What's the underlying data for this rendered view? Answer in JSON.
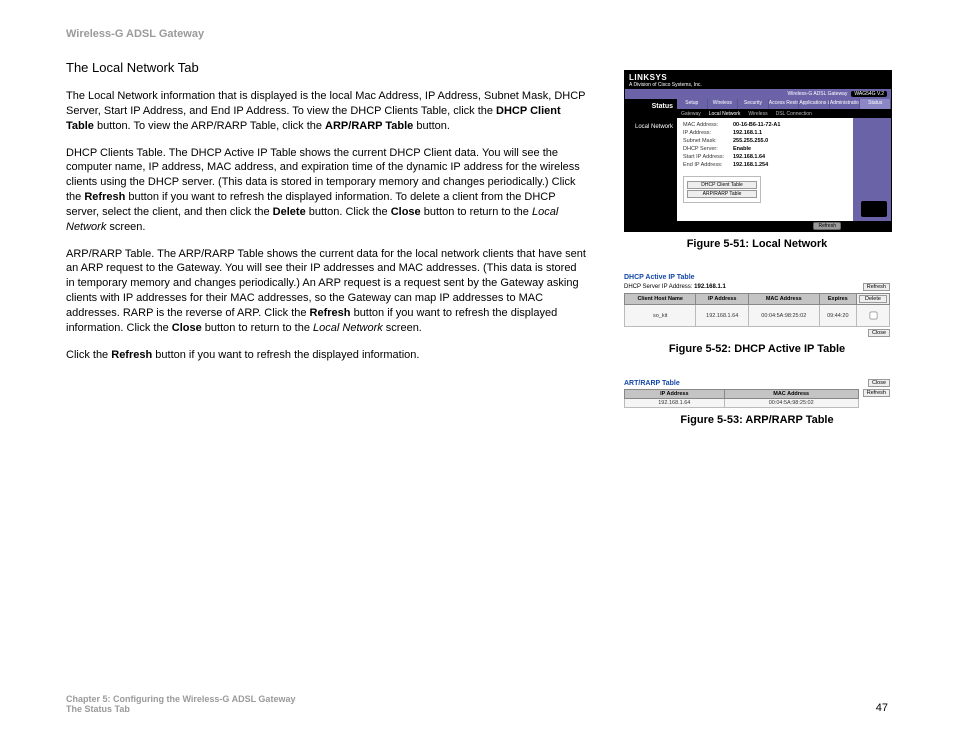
{
  "header": {
    "product": "Wireless-G ADSL Gateway"
  },
  "section": {
    "title": "The Local Network Tab",
    "p1_a": "The Local Network information that is displayed is the local Mac Address, IP Address, Subnet Mask, DHCP Server, Start IP Address, and End IP Address. To view the DHCP Clients Table, click the ",
    "p1_b1": "DHCP Client Table",
    "p1_c": " button. To view the ARP/RARP Table, click the ",
    "p1_b2": "ARP/RARP Table",
    "p1_d": " button.",
    "p2_a": "DHCP Clients Table. The DHCP Active IP Table shows the current DHCP Client data. You will see the computer name, IP address, MAC address, and expiration time of the dynamic IP address for the wireless clients using the DHCP server. (This data is stored in temporary memory and changes periodically.) Click the ",
    "p2_b1": "Refresh",
    "p2_c": " button if you want to refresh the displayed information. To delete a client from the DHCP server, select the client, and then click the ",
    "p2_b2": "Delete",
    "p2_d": " button. Click the ",
    "p2_b3": "Close",
    "p2_e": " button to return to the ",
    "p2_i": "Local Network",
    "p2_f": " screen.",
    "p3_a": "ARP/RARP Table. The ARP/RARP Table shows the current data for the local network clients that have sent an ARP request to the Gateway. You will see their IP addresses and MAC addresses. (This data is stored in temporary memory and changes periodically.) An ARP request is a request sent by the Gateway asking clients with IP addresses for their MAC addresses, so the Gateway can map IP addresses to MAC addresses. RARP is the reverse of ARP. Click the ",
    "p3_b1": "Refresh",
    "p3_c": " button if you want to refresh the displayed information. Click the ",
    "p3_b2": "Close",
    "p3_d": " button to return to the ",
    "p3_i": "Local Network",
    "p3_e": " screen.",
    "p4_a": "Click the ",
    "p4_b1": "Refresh",
    "p4_c": " button if you want to refresh the displayed information."
  },
  "fig51": {
    "caption": "Figure 5-51: Local Network",
    "brand": "LINKSYS",
    "brand_sub": "A Division of Cisco Systems, Inc.",
    "firmware": "Wireless-G ADSL Gateway",
    "model": "WAG54G V.2",
    "status_label": "Status",
    "tabs": [
      "Setup",
      "Wireless",
      "Security",
      "Access Restrictions",
      "Applications & Gaming",
      "Administration",
      "Status"
    ],
    "subtabs": [
      "Gateway",
      "Local Network",
      "Wireless",
      "DSL Connection"
    ],
    "side_label": "Local Network",
    "rows": [
      {
        "k": "MAC Address:",
        "v": "00-16-B6-11-72-A1"
      },
      {
        "k": "IP Address:",
        "v": "192.168.1.1"
      },
      {
        "k": "Subnet Mask:",
        "v": "255.255.255.0"
      },
      {
        "k": "DHCP Server:",
        "v": "Enable"
      },
      {
        "k": "Start IP Address:",
        "v": "192.168.1.64"
      },
      {
        "k": "End IP Address:",
        "v": "192.168.1.254"
      }
    ],
    "btn1": "DHCP Client Table",
    "btn2": "ARP/RARP Table",
    "refresh": "Refresh"
  },
  "fig52": {
    "caption": "Figure 5-52: DHCP Active IP Table",
    "title": "DHCP Active IP Table",
    "server_label": "DHCP Server IP Address:",
    "server_value": "192.168.1.1",
    "refresh": "Refresh",
    "headers": [
      "Client Host Name",
      "IP Address",
      "MAC Address",
      "Expires"
    ],
    "row": [
      "so_kit",
      "192.168.1.64",
      "00:04:5A:98:25:02",
      "09:44:20"
    ],
    "delete": "Delete",
    "close": "Close"
  },
  "fig53": {
    "caption": "Figure 5-53: ARP/RARP Table",
    "title": "ART/RARP Table",
    "close": "Close",
    "refresh": "Refresh",
    "headers": [
      "IP Address",
      "MAC Address"
    ],
    "row": [
      "192.168.1.64",
      "00:04:5A:98:25:02"
    ]
  },
  "footer": {
    "line1": "Chapter 5: Configuring the Wireless-G ADSL Gateway",
    "line2": "The Status Tab",
    "page": "47"
  }
}
